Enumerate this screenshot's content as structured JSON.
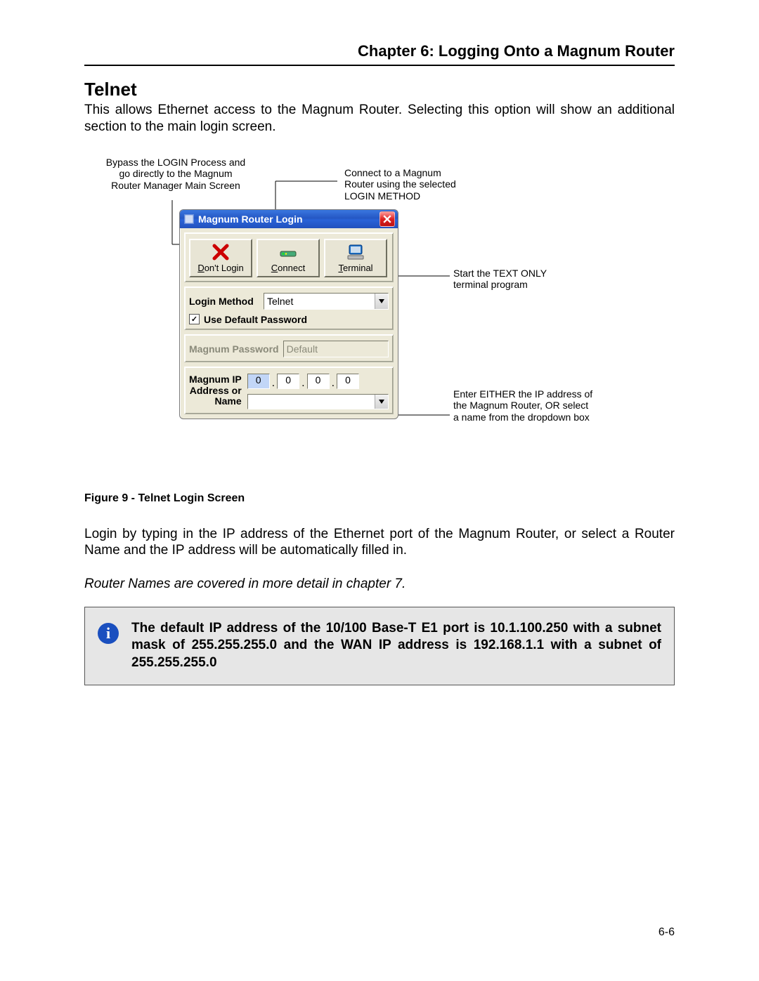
{
  "header": {
    "chapter": "Chapter 6: Logging Onto a Magnum Router"
  },
  "section": {
    "title": "Telnet",
    "intro": "This allows Ethernet access to the Magnum Router.  Selecting this option will show an additional section to the main login screen."
  },
  "callouts": {
    "bypass": "Bypass the LOGIN Process and go directly to the Magnum Router Manager Main Screen",
    "connect": "Connect to a Magnum Router using the selected LOGIN METHOD",
    "terminal": "Start the TEXT ONLY terminal program",
    "ip_entry": "Enter EITHER the IP address of the Magnum Router, OR select a name from the dropdown box"
  },
  "window": {
    "title": "Magnum Router Login",
    "buttons": {
      "dont_login": "Don't Login",
      "connect": "Connect",
      "terminal": "Terminal"
    },
    "login_method_label": "Login Method",
    "login_method_value": "Telnet",
    "use_default_pw_label": "Use Default Password",
    "use_default_pw_checked": "✓",
    "password_label": "Magnum Password",
    "password_value": "Default",
    "ip_label_line1": "Magnum IP",
    "ip_label_line2": "Address or",
    "ip_label_line3": "Name",
    "ip": {
      "o1": "0",
      "o2": "0",
      "o3": "0",
      "o4": "0"
    }
  },
  "figure_caption": "Figure 9 - Telnet Login Screen",
  "post_figure": {
    "p1": "Login by typing in the IP address of the Ethernet port of the Magnum Router, or select a Router Name and the IP address will be automatically filled in.",
    "p2": "Router Names are covered in more detail in chapter 7."
  },
  "info_box": {
    "text": "The default IP address of the 10/100 Base-T E1 port is 10.1.100.250 with a subnet mask of 255.255.255.0 and the WAN IP address is 192.168.1.1 with a subnet of 255.255.255.0"
  },
  "page_number": "6-6"
}
